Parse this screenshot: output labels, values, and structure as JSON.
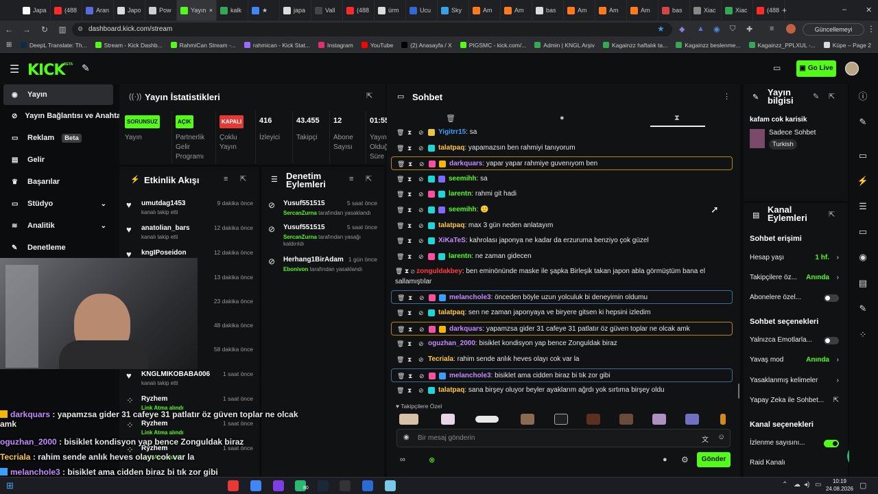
{
  "browser": {
    "tabs": [
      {
        "label": "Japa",
        "color": "#ffffff"
      },
      {
        "label": "(488",
        "color": "#ff2b2b"
      },
      {
        "label": "Aran",
        "color": "#5b6bdc"
      },
      {
        "label": "Japo",
        "color": "#dcdcdc"
      },
      {
        "label": "Pow",
        "color": "#cfcfcf"
      },
      {
        "label": "Yayın",
        "color": "#53fc18",
        "active": true
      },
      {
        "label": "kalk",
        "color": "#34a853"
      },
      {
        "label": "★",
        "color": "#4285f4"
      },
      {
        "label": "japa",
        "color": "#dcdcdc"
      },
      {
        "label": "Vall",
        "color": "#444"
      },
      {
        "label": "(488",
        "color": "#ff2b2b"
      },
      {
        "label": "ürm",
        "color": "#dcdcdc"
      },
      {
        "label": "Ucu",
        "color": "#3367d6"
      },
      {
        "label": "Sky",
        "color": "#3aa0e8"
      },
      {
        "label": "Am",
        "color": "#ff7a1a"
      },
      {
        "label": "Am",
        "color": "#ff7a1a"
      },
      {
        "label": "bas",
        "color": "#dcdcdc"
      },
      {
        "label": "Am",
        "color": "#ff7a1a"
      },
      {
        "label": "Am",
        "color": "#ff7a1a"
      },
      {
        "label": "Am",
        "color": "#ff7a1a"
      },
      {
        "label": "bas",
        "color": "#d64545"
      },
      {
        "label": "Xiac",
        "color": "#888"
      },
      {
        "label": "Xiac",
        "color": "#34a853"
      },
      {
        "label": "(488",
        "color": "#ff2b2b"
      }
    ],
    "url": "dashboard.kick.com/stream",
    "update_label": "Güncellemeyi tamamla",
    "bookmarks": [
      {
        "label": "DeepL Translate: Th...",
        "color": "#0f2b46"
      },
      {
        "label": "Stream - Kick Dashb...",
        "color": "#53fc18"
      },
      {
        "label": "RahmiCan Stream -...",
        "color": "#53fc18"
      },
      {
        "label": "rahmican - Kick Stat...",
        "color": "#9b6bff"
      },
      {
        "label": "Instagram",
        "color": "#e1306c"
      },
      {
        "label": "YouTube",
        "color": "#ff0000"
      },
      {
        "label": "(2) Anasayfa / X",
        "color": "#000000"
      },
      {
        "label": "PIGSMC - kick.com/...",
        "color": "#53fc18"
      },
      {
        "label": "Admin | KNGL Arşiv",
        "color": "#34a853"
      },
      {
        "label": "Kagainzz haftalık ta...",
        "color": "#34a853"
      },
      {
        "label": "Kagainzz beslenme...",
        "color": "#34a853"
      },
      {
        "label": "Kagainzz_PPLXUL -...",
        "color": "#34a853"
      },
      {
        "label": "Küpe – Page 2",
        "color": "#dcdcdc"
      }
    ]
  },
  "app": {
    "logo": "KICK",
    "beta": "BETA",
    "go_live": "Go Live"
  },
  "nav": [
    {
      "label": "Yayın",
      "icon": "antenna-icon",
      "selected": true
    },
    {
      "label": "Yayın Bağlantısı ve Anahtarı",
      "icon": "link-icon"
    },
    {
      "label": "Reklam",
      "icon": "ad-icon",
      "badge": "Beta"
    },
    {
      "label": "Gelir",
      "icon": "wallet-icon"
    },
    {
      "label": "Başarılar",
      "icon": "trophy-icon"
    },
    {
      "label": "Stüdyo",
      "icon": "studio-icon",
      "chevron": true
    },
    {
      "label": "Analitik",
      "icon": "chart-icon",
      "chevron": true
    },
    {
      "label": "Denetleme",
      "icon": "hammer-icon"
    }
  ],
  "stats": {
    "title": "Yayın İstatistikleri",
    "items": [
      {
        "badge": "SORUNSUZ",
        "label": "Yayın"
      },
      {
        "badge": "AÇIK",
        "label": "Partnerlik Gelir Programı"
      },
      {
        "badge": "KAPALI",
        "label": "Çoklu Yayın"
      },
      {
        "value": "416",
        "label": "İzleyici"
      },
      {
        "value": "43.455",
        "label": "Takipçi"
      },
      {
        "value": "12",
        "label": "Abone Sayısı"
      },
      {
        "value": "01:55",
        "label": "Yayın Olduğu Süre"
      }
    ]
  },
  "activity": {
    "title": "Etkinlik Akışı",
    "items": [
      {
        "name": "umutdag1453",
        "sub": "kanalı takip etti",
        "time": "9 dakika önce"
      },
      {
        "name": "anatolian_bars",
        "sub": "kanalı takip etti",
        "time": "12 dakika önce"
      },
      {
        "name": "kngIPoseidon",
        "sub": "",
        "time": "12 dakika önce"
      },
      {
        "name": "",
        "sub": "",
        "time": "13 dakika önce"
      },
      {
        "name": "",
        "sub": "",
        "time": "23 dakika önce"
      },
      {
        "name": "",
        "sub": "",
        "time": "48 dakika önce"
      },
      {
        "name": "",
        "sub": "",
        "time": "58 dakika önce"
      },
      {
        "name": "KNGLMIKOBABA006",
        "sub": "kanalı takip etti",
        "time": "1 saat önce"
      },
      {
        "name": "Ryzhem",
        "sub": "Link Atma alındı",
        "time": "1 saat önce"
      },
      {
        "name": "Ryzhem",
        "sub": "Link Atma alındı",
        "time": "1 saat önce"
      },
      {
        "name": "Ryzhem",
        "sub": "Link Atma alındı",
        "time": "1 saat önce"
      }
    ]
  },
  "moderation": {
    "title": "Denetim Eylemleri",
    "items": [
      {
        "name": "Yusuf551515",
        "by": "SercanZurna",
        "action": "tarafından yasaklandı",
        "time": "5 saat önce"
      },
      {
        "name": "Yusuf551515",
        "by": "SercanZurna",
        "action": "tarafından yasağı kaldırıldı",
        "time": "5 saat önce"
      },
      {
        "name": "Herhang1BirAdam",
        "by": "Ebonivon",
        "action": "tarafından yasaklandı",
        "time": "1 gün önce"
      }
    ]
  },
  "chat": {
    "title": "Sohbet",
    "messages": [
      {
        "user": "Yigitrr15",
        "color": "#3aa0ff",
        "text": ": sa",
        "badges": [
          "#e8c547"
        ]
      },
      {
        "user": "talatpaq",
        "color": "#ffc93c",
        "text": ": yapamazsın ben rahmiyi tanıyorum",
        "badges": [
          "#1fd5d5"
        ]
      },
      {
        "user": "darkquars",
        "color": "#c48bff",
        "text": ": yapar yapar rahmiye guvenıyom ben",
        "badges": [
          "#ff4fa0",
          "#f5b800"
        ],
        "highlight": "#b8860b"
      },
      {
        "user": "seemihh",
        "color": "#53fc18",
        "text": ": sa",
        "badges": [
          "#1fd5d5",
          "#7b6cff"
        ]
      },
      {
        "user": "larentn",
        "color": "#53fc18",
        "text": ": rahmi git hadi",
        "badges": [
          "#ff4fa0",
          "#1fd5d5"
        ]
      },
      {
        "user": "seemihh",
        "color": "#53fc18",
        "text": ": 🙂",
        "badges": [
          "#1fd5d5",
          "#7b6cff"
        ]
      },
      {
        "user": "talatpaq",
        "color": "#ffc93c",
        "text": ": max 3 gün neden anlatayım",
        "badges": [
          "#1fd5d5"
        ]
      },
      {
        "user": "XiKaTeS",
        "color": "#c48bff",
        "text": ": kahrolası japonya ne kadar da erzuruma benziyo çok güzel",
        "badges": [
          "#1fd5d5"
        ]
      },
      {
        "user": "larentn",
        "color": "#53fc18",
        "text": ": ne zaman gidecen",
        "badges": [
          "#ff4fa0",
          "#1fd5d5"
        ]
      },
      {
        "user": "zonguldakbey",
        "color": "#ff3b3b",
        "text": ": ben eminönünde maske ile şapka Birleşik takan japon abla görmüştüm bana el sallamıştılar",
        "badges": []
      },
      {
        "user": "melanchole3",
        "color": "#c48bff",
        "text": ": önceden böyle uzun yolculuk bi deneyimin oldumu",
        "badges": [
          "#ff4fa0",
          "#3aa0ff"
        ],
        "highlight": "#3a6e8a"
      },
      {
        "user": "talatpaq",
        "color": "#ffc93c",
        "text": ": sen ne zaman japonyaya ve biryere gitsen ki hepsini izledim",
        "badges": [
          "#1fd5d5"
        ]
      },
      {
        "user": "darkquars",
        "color": "#c48bff",
        "text": ": yapamzsa gider 31 cafeye 31 patlatır öz güven toplar ne olcak amk",
        "badges": [
          "#ff4fa0",
          "#f5b800"
        ],
        "highlight": "#b8860b"
      },
      {
        "user": "oguzhan_2000",
        "color": "#c48bff",
        "text": ": bisiklet kondisyon yap bence Zonguldak biraz",
        "badges": []
      },
      {
        "user": "Tecriala",
        "color": "#ffc93c",
        "text": ": rahim sende anlık heves olayı cok var la",
        "badges": []
      },
      {
        "user": "melanchole3",
        "color": "#c48bff",
        "text": ": bisiklet ama cidden biraz bi tık zor gibi",
        "badges": [
          "#ff4fa0",
          "#3aa0ff"
        ],
        "highlight": "#3a6e8a"
      },
      {
        "user": "talatpaq",
        "color": "#ffc93c",
        "text": ": sana birşey oluyor beyler ayaklarım ağrdı yok sırtıma birşey oldu",
        "badges": [
          "#1fd5d5"
        ]
      }
    ],
    "emote_section": "Takipçilere Özel",
    "input_placeholder": "Bir mesaj gönderin",
    "send_label": "Gönder"
  },
  "stream_info": {
    "title": "Yayın bilgisi",
    "stream_title": "kafam cok karisik",
    "category": "Sadece Sohbet",
    "tag": "Turkish"
  },
  "channel_actions": {
    "title": "Kanal Eylemleri",
    "chat_access": "Sohbet erişimi",
    "account_age": {
      "label": "Hesap yaşı",
      "value": "1 hf."
    },
    "followers_only": {
      "label": "Takipçilere öz...",
      "value": "Anında"
    },
    "subs_only": {
      "label": "Abonelere özel..."
    },
    "chat_options": "Sohbet seçenekleri",
    "emotes_only": {
      "label": "Yalnızca Emotlarla..."
    },
    "slow_mode": {
      "label": "Yavaş mod",
      "value": "Anında"
    },
    "banned_words": {
      "label": "Yasaklanmış kelimeler"
    },
    "ai_chat": {
      "label": "Yapay Zeka ile Sohbet..."
    },
    "channel_options": "Kanal seçenekleri",
    "viewer_count": {
      "label": "İzlenme sayısını..."
    },
    "raid": {
      "label": "Raid Kanalı"
    }
  },
  "overlay_chat": [
    {
      "user": "darkquars",
      "color": "#c48bff",
      "text": " : yapamzsa gider 31 cafeye 31 patlatır öz güven toplar ne olcak",
      "cont": "amk"
    },
    {
      "user": "oguzhan_2000",
      "color": "#c48bff",
      "text": " : bisiklet kondisyon yap bence Zonguldak biraz"
    },
    {
      "user": "Tecriala",
      "color": "#ffc93c",
      "text": " : rahim sende anlık heves olayı cok var la"
    },
    {
      "user": "melanchole3",
      "color": "#c48bff",
      "text": " : bisiklet ama cidden biraz bi tık zor gibi"
    },
    {
      "user": "talatpaq",
      "color": "#ffc93c",
      "text": " : sana birşey oluyor beyler ayaklarım ağrdı yok sırtıma birşey oldu"
    }
  ],
  "taskbar": {
    "time": "10:19",
    "date": "24.08.2026",
    "badge": "80"
  },
  "floating_badge": "1"
}
